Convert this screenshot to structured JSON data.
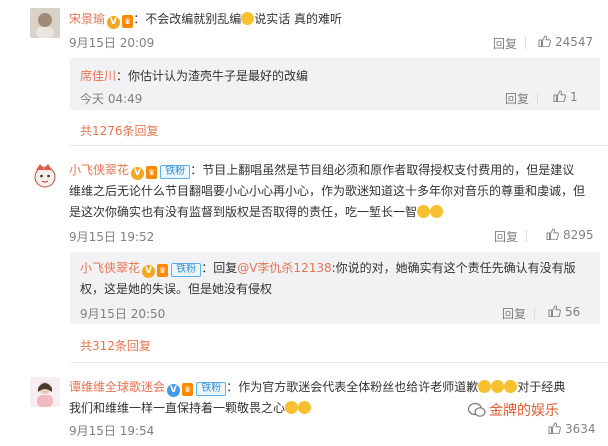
{
  "comments": [
    {
      "username": "宋景瑜",
      "separator": "：",
      "text": "不会改编就别乱编",
      "text_after_emoji": "说实话 真的难听",
      "time": "9月15日 20:09",
      "reply_label": "回复",
      "likes": "24547",
      "sub_reply": {
        "username": "席佳川",
        "separator": "：",
        "text": "你估计认为渣壳牛子是最好的改编",
        "time": "今天 04:49",
        "reply_label": "回复",
        "likes": "1"
      },
      "more_replies": "共1276条回复"
    },
    {
      "username": "小飞侠翠花",
      "fan_badge": "铁粉",
      "separator": "：",
      "line1": "节目上翻唱虽然是节目组必须和原作者取得授权支付费用的，但是建议",
      "line2": "维维之后无论什么节目翻唱要小心小心再小心，作为歌迷知道这十多年你对音乐的尊重和虔诚，但",
      "line3": "是这次你确实也有没有监督到版权是否取得的责任，吃一堑长一智",
      "time": "9月15日 19:52",
      "reply_label": "回复",
      "likes": "8295",
      "sub_reply": {
        "username": "小飞侠翠花",
        "fan_badge": "铁粉",
        "separator": "：",
        "reply_word": "回复",
        "mention": "@V李仇杀12138",
        "line1": ":你说的对，她确实有这个责任先确认有没有版",
        "line2": "权，这是她的失误。但是她没有侵权",
        "time": "9月15日 20:50",
        "reply_label": "回复",
        "likes": "56"
      },
      "more_replies": "共312条回复"
    },
    {
      "username": "谭维维全球歌迷会",
      "fan_badge": "铁粉",
      "separator": "：",
      "line1": "作为官方歌迷会代表全体粉丝也给许老师道歉",
      "line1_after": "对于经典",
      "line2": "我们和维维一样一直保持着一颗敬畏之心",
      "time": "9月15日 19:54",
      "likes": "3634"
    }
  ],
  "watermark": "金牌的娱乐",
  "colors": {
    "username": "#eb7350",
    "link": "#eb7350",
    "gray": "#808080",
    "subbox": "#f2f2f5"
  }
}
